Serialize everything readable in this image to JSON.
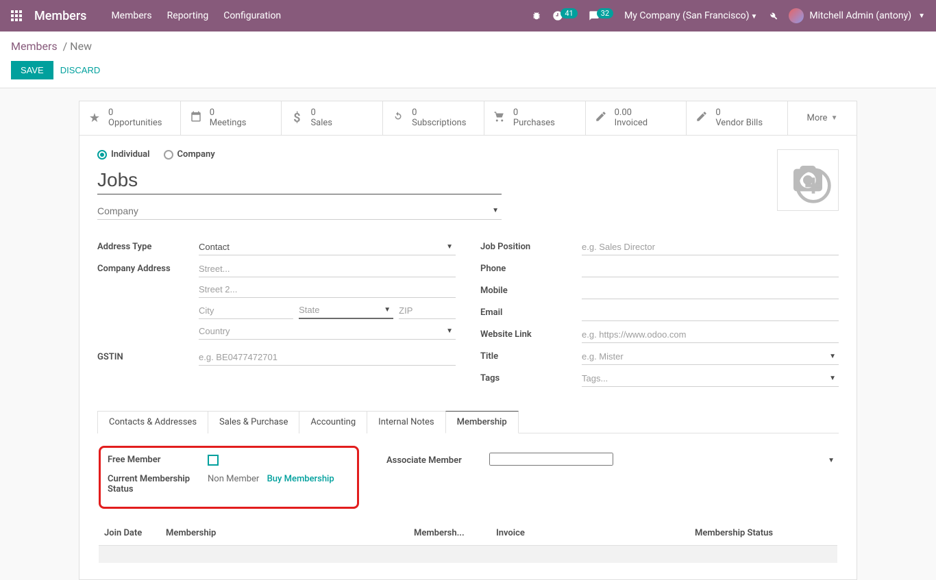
{
  "topnav": {
    "brand": "Members",
    "links": [
      "Members",
      "Reporting",
      "Configuration"
    ],
    "badge1": "41",
    "badge2": "32",
    "company": "My Company (San Francisco)",
    "user": "Mitchell Admin (antony)"
  },
  "cp": {
    "breadcrumb_root": "Members",
    "breadcrumb_current": "New",
    "save": "SAVE",
    "discard": "DISCARD"
  },
  "stats": {
    "opportunities": {
      "val": "0",
      "label": "Opportunities"
    },
    "meetings": {
      "val": "0",
      "label": "Meetings"
    },
    "sales": {
      "val": "0",
      "label": "Sales"
    },
    "subscriptions": {
      "val": "0",
      "label": "Subscriptions"
    },
    "purchases": {
      "val": "0",
      "label": "Purchases"
    },
    "invoiced": {
      "val": "0.00",
      "label": "Invoiced"
    },
    "vendor_bills": {
      "val": "0",
      "label": "Vendor Bills"
    },
    "more": "More"
  },
  "form": {
    "radio_individual": "Individual",
    "radio_company": "Company",
    "name": "Jobs",
    "company_placeholder": "Company",
    "left": {
      "address_type_lbl": "Address Type",
      "address_type_val": "Contact",
      "company_address_lbl": "Company Address",
      "street_ph": "Street...",
      "street2_ph": "Street 2...",
      "city_ph": "City",
      "state_ph": "State",
      "zip_ph": "ZIP",
      "country_ph": "Country",
      "gstin_lbl": "GSTIN",
      "gstin_ph": "e.g. BE0477472701"
    },
    "right": {
      "job_position_lbl": "Job Position",
      "job_position_ph": "e.g. Sales Director",
      "phone_lbl": "Phone",
      "mobile_lbl": "Mobile",
      "email_lbl": "Email",
      "website_lbl": "Website Link",
      "website_ph": "e.g. https://www.odoo.com",
      "title_lbl": "Title",
      "title_ph": "e.g. Mister",
      "tags_lbl": "Tags",
      "tags_ph": "Tags..."
    }
  },
  "tabs": {
    "t1": "Contacts & Addresses",
    "t2": "Sales & Purchase",
    "t3": "Accounting",
    "t4": "Internal Notes",
    "t5": "Membership"
  },
  "membership": {
    "free_member_lbl": "Free Member",
    "current_status_lbl": "Current Membership Status",
    "current_status_val": "Non Member",
    "buy": "Buy Membership",
    "associate_lbl": "Associate Member",
    "table": {
      "c1": "Join Date",
      "c2": "Membership",
      "c3": "Membersh...",
      "c4": "Invoice",
      "c5": "Membership Status"
    }
  }
}
